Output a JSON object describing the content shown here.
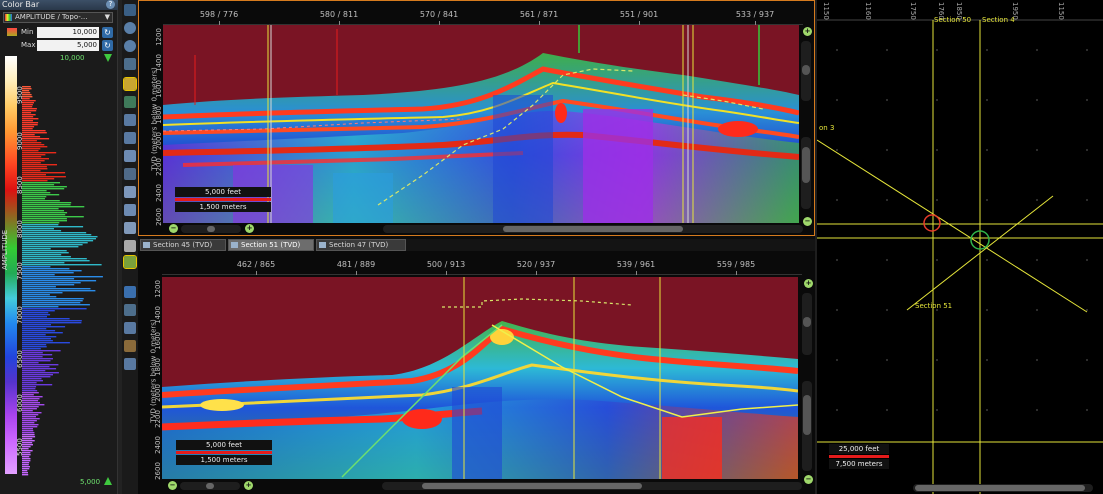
{
  "colorbar": {
    "title": "Color Bar",
    "attribute": "AMPLITUDE / Topo-...",
    "min_label": "Min",
    "min_value": "10,000",
    "max_label": "Max",
    "max_value": "5,000",
    "top_value": "10,000",
    "bottom_value": "5,000",
    "axis_label": "AMPLITUDE",
    "ticks": [
      "9500",
      "9000",
      "8500",
      "8000",
      "7500",
      "7000",
      "6500",
      "6000",
      "5500"
    ]
  },
  "top_section": {
    "ruler": [
      "598 / 776",
      "580 / 811",
      "570 / 841",
      "561 / 871",
      "551 / 901",
      "533 / 937"
    ],
    "depth_title": "TVD (meters below 0 meters)",
    "depths": [
      "1200",
      "1400",
      "1600",
      "1800",
      "2000",
      "2200",
      "2400",
      "2600"
    ],
    "scale_feet": "5,000 feet",
    "scale_meters": "1,500 meters"
  },
  "tabs": [
    {
      "label": "Section 45 (TVD)",
      "active": false
    },
    {
      "label": "Section 51 (TVD)",
      "active": true
    },
    {
      "label": "Section 47 (TVD)",
      "active": false
    }
  ],
  "bottom_section": {
    "ruler": [
      "462 / 865",
      "481 / 889",
      "500 / 913",
      "520 / 937",
      "539 / 961",
      "559 / 985"
    ],
    "depth_title": "TVD (meters below 0 meters)",
    "depths": [
      "1200",
      "1400",
      "1600",
      "1800",
      "2000",
      "2200",
      "2400",
      "2600"
    ],
    "scale_feet": "5,000 feet",
    "scale_meters": "1,500 meters"
  },
  "map": {
    "grid_labels": [
      "1150",
      "1160",
      "1750",
      "1760",
      "1850",
      "1950",
      "1150"
    ],
    "section_50": "Section 50",
    "section_4": "Section 4",
    "section_on3": "on 3",
    "section_51": "Section 51",
    "scale_feet": "25,000 feet",
    "scale_meters": "7,500 meters"
  },
  "colors": {
    "accent_border": "#d67b1e",
    "well_line": "#e5e53a",
    "scale_red": "#e51b1b",
    "marker_green": "#3fc93f"
  }
}
